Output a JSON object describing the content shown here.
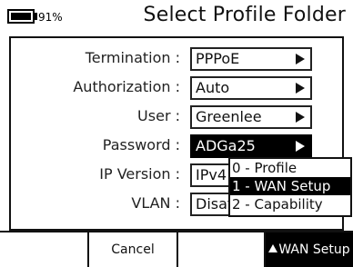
{
  "header": {
    "battery_percent": "91%",
    "battery_level": 0.91,
    "title": "Select Profile Folder"
  },
  "form": {
    "rows": [
      {
        "label": "Termination :",
        "value": "PPPoE"
      },
      {
        "label": "Authorization :",
        "value": "Auto"
      },
      {
        "label": "User :",
        "value": "Greenlee"
      },
      {
        "label": "Password :",
        "value": "ADGa25"
      },
      {
        "label": "IP Version :",
        "value": "IPv4"
      },
      {
        "label": "VLAN :",
        "value": "Disat"
      }
    ]
  },
  "dropdown": {
    "items": [
      "0 - Profile",
      "1 - WAN Setup",
      "2 - Capability"
    ],
    "selected_index": 1
  },
  "softkeys": {
    "key1": "",
    "key2": "Cancel",
    "key3": "",
    "key4": "WAN Setup"
  },
  "icons": {
    "battery": "battery-icon",
    "field_arrow": "triangle-right-icon",
    "softkey_arrow": "triangle-up-icon"
  },
  "colors": {
    "selected_bg": "#000000",
    "selected_fg": "#ffffff",
    "background": "#ffffff"
  }
}
